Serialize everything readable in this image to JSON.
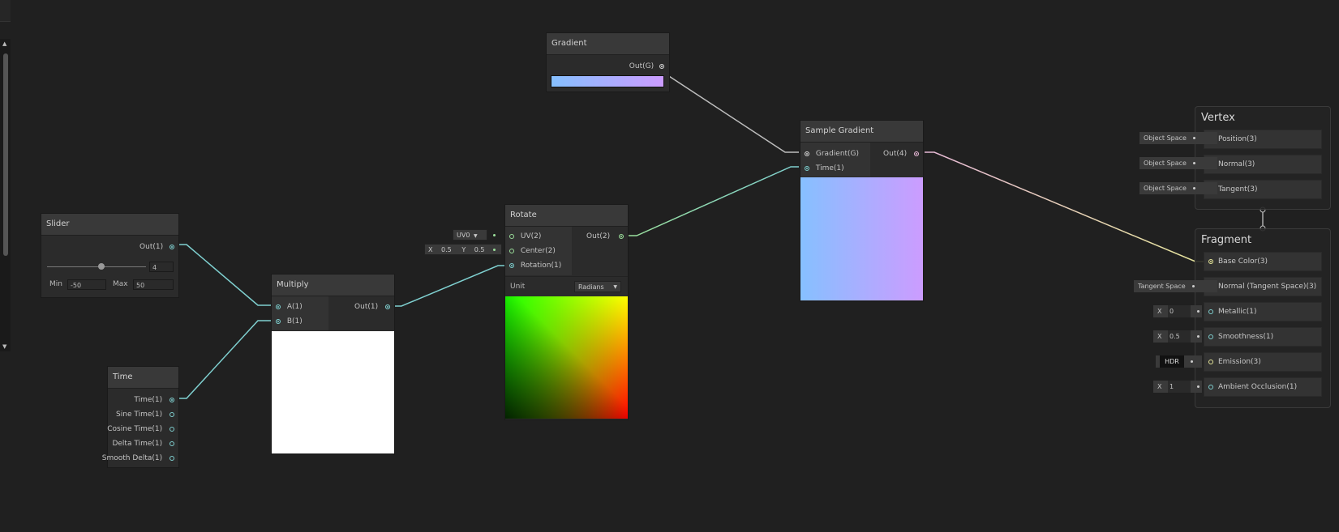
{
  "scrollbar": {
    "up_icon": "▲",
    "down_icon": "▼"
  },
  "gradient_node": {
    "title": "Gradient",
    "out": "Out(G)",
    "gradient_colors": [
      "#86c0ff",
      "#cc9cff"
    ]
  },
  "sample_gradient_node": {
    "title": "Sample Gradient",
    "in_gradient": "Gradient(G)",
    "in_time": "Time(1)",
    "out": "Out(4)",
    "preview_colors": [
      "#86c0ff",
      "#cc9cff"
    ]
  },
  "slider_node": {
    "title": "Slider",
    "out": "Out(1)",
    "value": "4",
    "min_label": "Min",
    "min_value": "-50",
    "max_label": "Max",
    "max_value": "50",
    "slider_fraction": 0.54
  },
  "time_node": {
    "title": "Time",
    "outputs": [
      "Time(1)",
      "Sine Time(1)",
      "Cosine Time(1)",
      "Delta Time(1)",
      "Smooth Delta(1)"
    ]
  },
  "multiply_node": {
    "title": "Multiply",
    "in_a": "A(1)",
    "in_b": "B(1)",
    "out": "Out(1)",
    "preview_color": "#ffffff"
  },
  "rotate_node": {
    "title": "Rotate",
    "in_uv": "UV(2)",
    "in_center": "Center(2)",
    "in_rotation": "Rotation(1)",
    "out": "Out(2)",
    "uv_default": "UV0",
    "center_x_label": "X",
    "center_x": "0.5",
    "center_y_label": "Y",
    "center_y": "0.5",
    "unit_label": "Unit",
    "unit_value": "Radians"
  },
  "vertex_master": {
    "title": "Vertex",
    "slots": [
      {
        "label": "Position(3)",
        "default": "Object Space"
      },
      {
        "label": "Normal(3)",
        "default": "Object Space"
      },
      {
        "label": "Tangent(3)",
        "default": "Object Space"
      }
    ]
  },
  "fragment_master": {
    "title": "Fragment",
    "slots": [
      {
        "label": "Base Color(3)",
        "default": ""
      },
      {
        "label": "Normal (Tangent Space)(3)",
        "default": "Tangent Space"
      },
      {
        "label": "Metallic(1)",
        "default_label": "X",
        "default": "0"
      },
      {
        "label": "Smoothness(1)",
        "default_label": "X",
        "default": "0.5"
      },
      {
        "label": "Emission(3)",
        "default": "HDR"
      },
      {
        "label": "Ambient Occlusion(1)",
        "default_label": "X",
        "default": "1"
      }
    ]
  },
  "colors": {
    "float_wire": "#7fd0d0",
    "vec2_wire": "#9be09b",
    "vec3_wire": "#e6e69a",
    "vec4_wire": "#e6b8d6",
    "gradient_wire": "#c8c8c8",
    "background": "#202020"
  }
}
